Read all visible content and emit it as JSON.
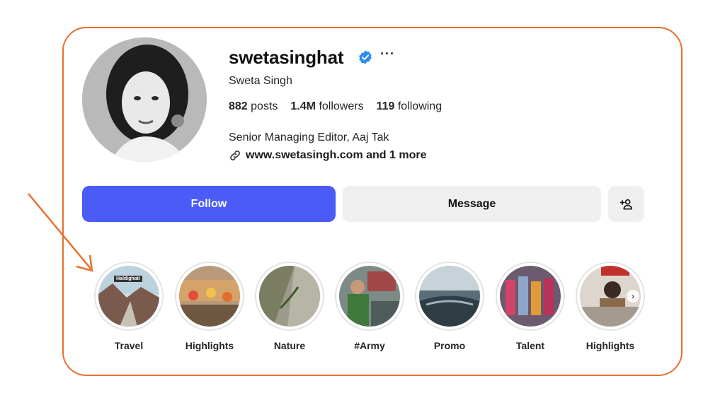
{
  "profile": {
    "username": "swetasinghat",
    "full_name": "Sweta Singh",
    "more_label": "···",
    "stats": {
      "posts_count": "882",
      "posts_label": "posts",
      "followers_count": "1.4M",
      "followers_label": "followers",
      "following_count": "119",
      "following_label": "following"
    },
    "bio": "Senior Managing Editor, Aaj Tak",
    "link": "www.swetasingh.com and 1 more"
  },
  "actions": {
    "follow_label": "Follow",
    "message_label": "Message",
    "add_user_icon": "add-user-icon"
  },
  "highlights": [
    {
      "label": "Travel",
      "tag": "Haldighati"
    },
    {
      "label": "Highlights"
    },
    {
      "label": "Nature"
    },
    {
      "label": "#Army"
    },
    {
      "label": "Promo"
    },
    {
      "label": "Talent"
    },
    {
      "label": "Highlights"
    }
  ],
  "colors": {
    "accent_follow": "#4a5cf5",
    "frame_annotation": "#e8702a",
    "verified_badge": "#2a8cf0"
  }
}
